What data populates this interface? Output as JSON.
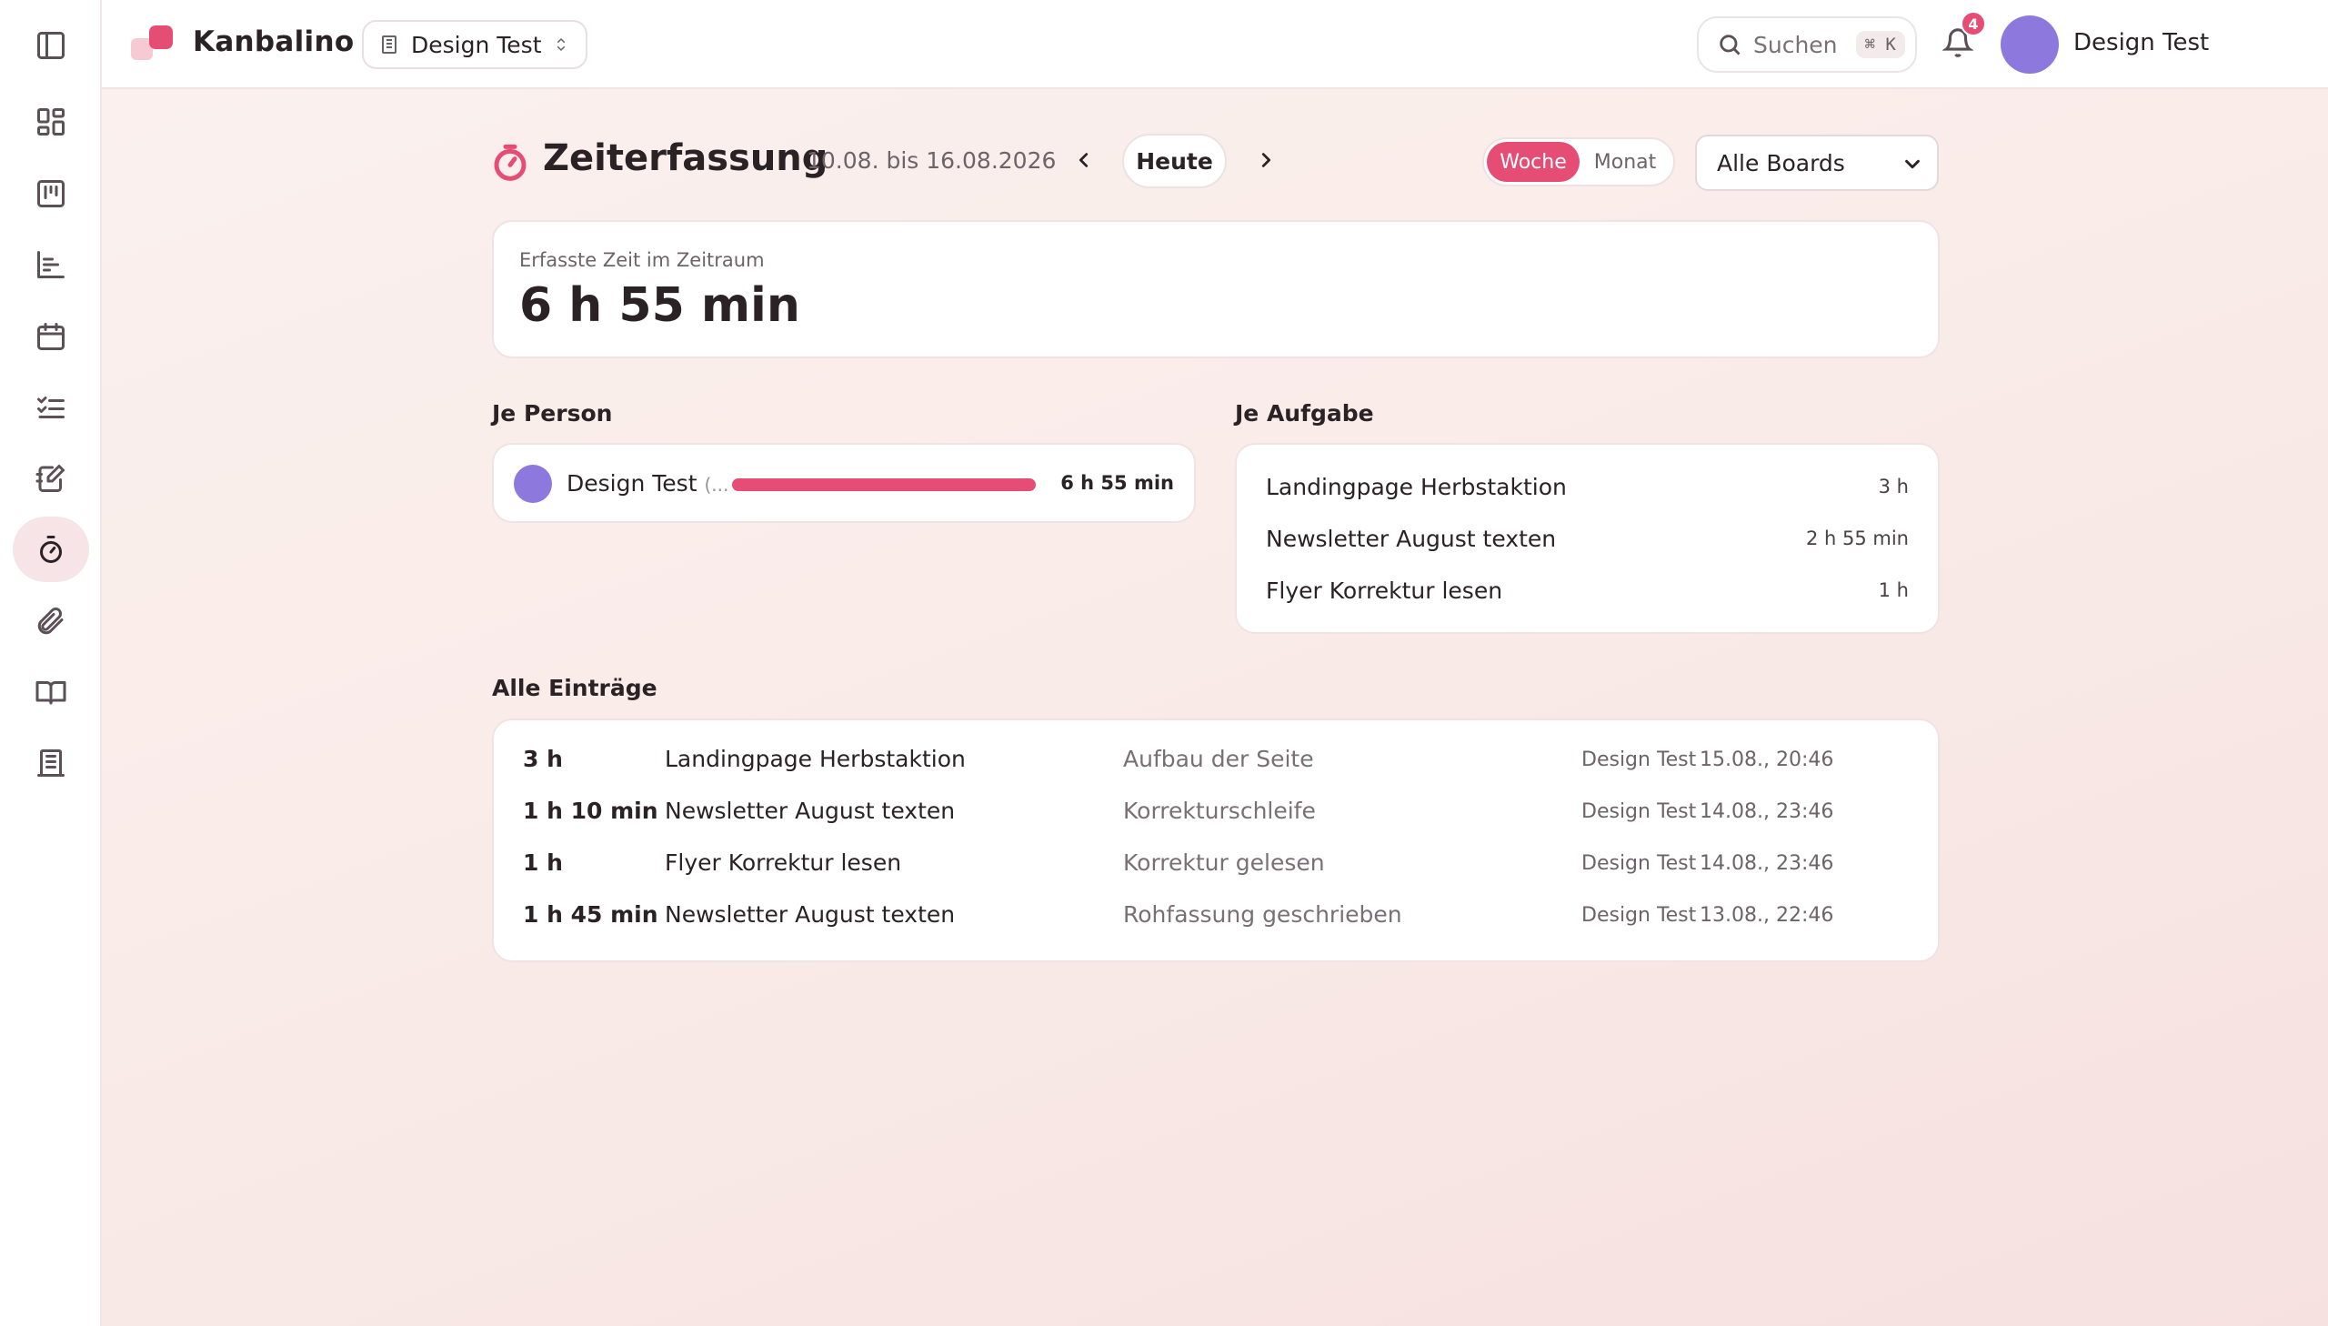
{
  "app": {
    "name": "Kanbalino",
    "workspace": "Design Test"
  },
  "colors": {
    "accent": "#e64d75",
    "avatar": "#8d78dd",
    "logo_light": "#f6c9d3"
  },
  "sidebar": {
    "items": [
      {
        "name": "toggle-sidebar",
        "icon": "sidebar-panel-icon"
      },
      {
        "name": "dashboard",
        "icon": "grid-icon"
      },
      {
        "name": "board",
        "icon": "kanban-icon"
      },
      {
        "name": "gantt",
        "icon": "timeline-icon"
      },
      {
        "name": "calendar",
        "icon": "calendar-icon"
      },
      {
        "name": "tasks",
        "icon": "checklist-icon"
      },
      {
        "name": "notes",
        "icon": "notebook-icon"
      },
      {
        "name": "time-tracking",
        "icon": "stopwatch-icon",
        "active": true
      },
      {
        "name": "attachments",
        "icon": "paperclip-icon"
      },
      {
        "name": "wiki",
        "icon": "book-icon"
      },
      {
        "name": "company",
        "icon": "building-icon"
      }
    ]
  },
  "topbar": {
    "search_label": "Suchen",
    "search_shortcut": "⌘ K",
    "notifications_count": "4",
    "user_name": "Design Test"
  },
  "page": {
    "title": "Zeiterfassung",
    "date_range": "10.08. bis 16.08.2026",
    "today_label": "Heute",
    "view_week": "Woche",
    "view_month": "Monat",
    "board_filter": "Alle Boards"
  },
  "summary": {
    "label": "Erfasste Zeit im Zeitraum",
    "total": "6 h 55 min"
  },
  "per_person": {
    "title": "Je Person",
    "rows": [
      {
        "name": "Design Test",
        "suffix": "(...",
        "time": "6 h 55 min",
        "share": 1.0
      }
    ]
  },
  "per_task": {
    "title": "Je Aufgabe",
    "rows": [
      {
        "name": "Landingpage Herbstaktion",
        "time": "3 h"
      },
      {
        "name": "Newsletter August texten",
        "time": "2 h 55 min"
      },
      {
        "name": "Flyer Korrektur lesen",
        "time": "1 h"
      }
    ]
  },
  "entries": {
    "title": "Alle Einträge",
    "rows": [
      {
        "duration": "3 h",
        "task": "Landingpage Herbstaktion",
        "note": "Aufbau der Seite",
        "user": "Design Test",
        "date": "15.08., 20:46"
      },
      {
        "duration": "1 h 10 min",
        "task": "Newsletter August texten",
        "note": "Korrekturschleife",
        "user": "Design Test",
        "date": "14.08., 23:46"
      },
      {
        "duration": "1 h",
        "task": "Flyer Korrektur lesen",
        "note": "Korrektur gelesen",
        "user": "Design Test",
        "date": "14.08., 23:46"
      },
      {
        "duration": "1 h 45 min",
        "task": "Newsletter August texten",
        "note": "Rohfassung geschrieben",
        "user": "Design Test",
        "date": "13.08., 22:46"
      }
    ]
  }
}
